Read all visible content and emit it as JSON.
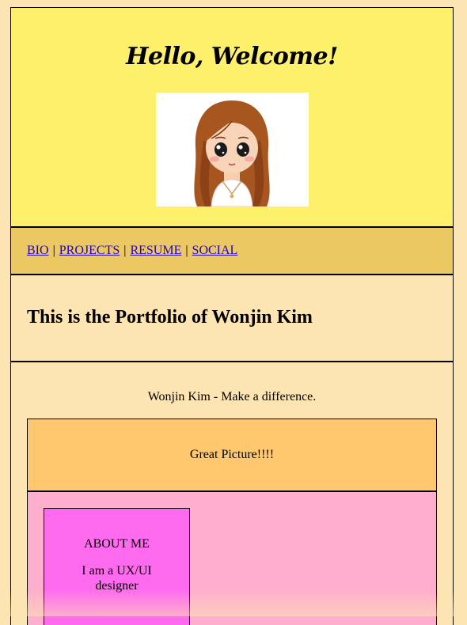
{
  "header": {
    "welcome": "Hello, Welcome!",
    "avatar_icon": "cartoon-girl-avatar"
  },
  "nav": {
    "items": [
      {
        "label": "BIO"
      },
      {
        "label": "PROJECTS"
      },
      {
        "label": "RESUME"
      },
      {
        "label": "SOCIAL"
      }
    ],
    "separator": "|"
  },
  "intro": {
    "title": "This is the Portfolio of Wonjin Kim"
  },
  "content": {
    "tagline": "Wonjin Kim - Make a difference.",
    "picture_caption": "Great Picture!!!!",
    "about": {
      "title": "ABOUT ME",
      "description": "I am a UX/UI designer"
    }
  },
  "colors": {
    "header_bg": "#fdf06b",
    "nav_bg": "#ecc862",
    "page_bg": "#fde4b3",
    "picture_bg": "#ffc86e",
    "pink_area_bg": "#ffaecd",
    "about_bg": "#ff6bef",
    "link": "#2200cc"
  }
}
